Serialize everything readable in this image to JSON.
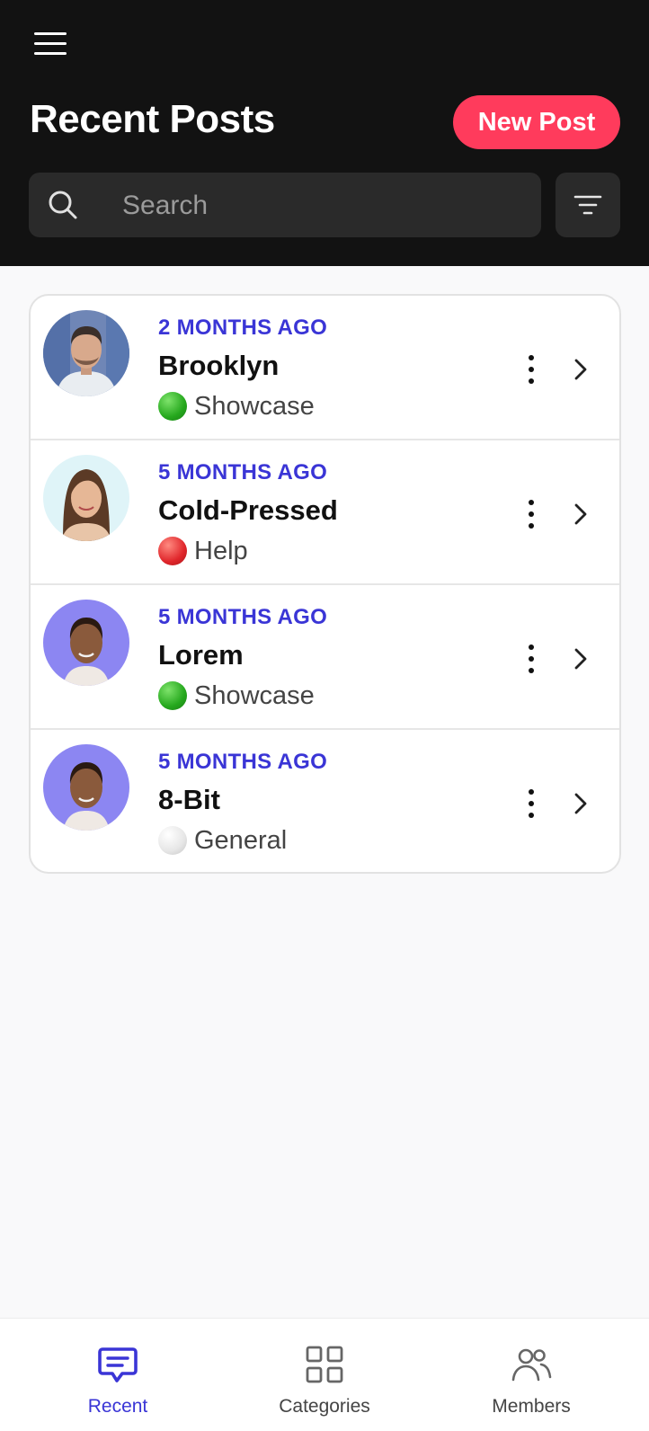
{
  "header": {
    "title": "Recent Posts",
    "new_post_label": "New Post",
    "search_placeholder": "Search"
  },
  "posts": [
    {
      "time": "2 MONTHS AGO",
      "title": "Brooklyn",
      "category": "Showcase",
      "category_color": "#2ecc40",
      "avatar": "man-avatar"
    },
    {
      "time": "5 MONTHS AGO",
      "title": "Cold-Pressed",
      "category": "Help",
      "category_color": "#e0262b",
      "avatar": "woman-avatar"
    },
    {
      "time": "5 MONTHS AGO",
      "title": "Lorem",
      "category": "Showcase",
      "category_color": "#2ecc40",
      "avatar": "woman-avatar-purple"
    },
    {
      "time": "5 MONTHS AGO",
      "title": "8-Bit",
      "category": "General",
      "category_color": "#e6e6e6",
      "avatar": "woman-avatar-purple"
    }
  ],
  "tabs": [
    {
      "label": "Recent",
      "icon": "chat-icon",
      "active": true
    },
    {
      "label": "Categories",
      "icon": "grid-icon",
      "active": false
    },
    {
      "label": "Members",
      "icon": "users-icon",
      "active": false
    }
  ],
  "colors": {
    "accent": "#3a35d6",
    "new_post": "#ff3b5c",
    "header_bg": "#121212"
  }
}
